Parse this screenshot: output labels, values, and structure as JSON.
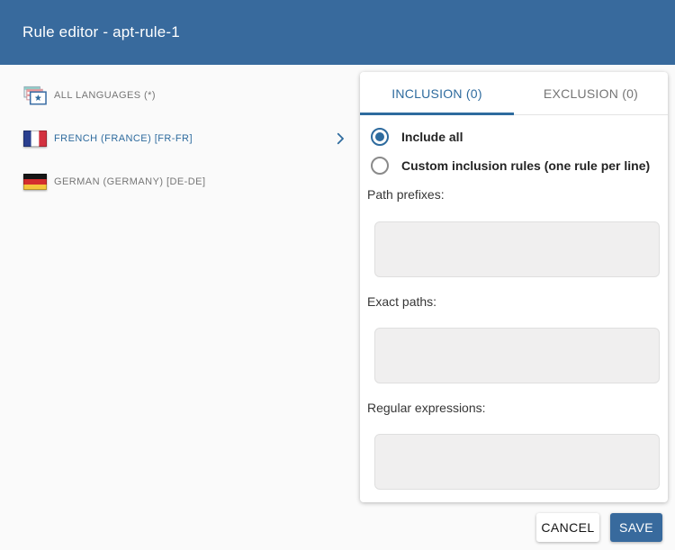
{
  "colors": {
    "primary_blue": "#386a9d",
    "accent_blue": "#2e6b9e",
    "muted_text": "#757575",
    "page_bg": "#fafafa",
    "card_bg": "#ffffff",
    "textarea_bg": "#f0efef"
  },
  "header": {
    "title": "Rule editor - apt-rule-1"
  },
  "languages": {
    "items": [
      {
        "label": "ALL LANGUAGES (*)",
        "icon": "all-languages-icon",
        "selected": false,
        "expandable": false
      },
      {
        "label": "FRENCH (FRANCE) [FR-FR]",
        "icon": "france-flag-icon",
        "selected": true,
        "expandable": true
      },
      {
        "label": "GERMAN (GERMANY) [DE-DE]",
        "icon": "germany-flag-icon",
        "selected": false,
        "expandable": false
      }
    ]
  },
  "panel": {
    "tabs": [
      {
        "label": "INCLUSION (0)",
        "active": true
      },
      {
        "label": "EXCLUSION (0)",
        "active": false
      }
    ],
    "radios": [
      {
        "label": "Include all",
        "selected": true
      },
      {
        "label": "Custom inclusion rules (one rule per line)",
        "selected": false
      }
    ],
    "fields": [
      {
        "label": "Path prefixes:",
        "value": ""
      },
      {
        "label": "Exact paths:",
        "value": ""
      },
      {
        "label": "Regular expressions:",
        "value": ""
      }
    ]
  },
  "footer": {
    "cancel_label": "CANCEL",
    "save_label": "SAVE"
  }
}
